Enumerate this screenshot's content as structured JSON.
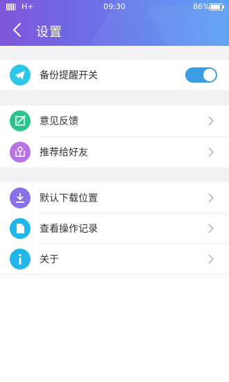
{
  "status_bar": {
    "network": "H+",
    "time": "09:30",
    "battery": "86%",
    "battery_level": 0.86
  },
  "header": {
    "title": "设置"
  },
  "settings": {
    "backup_reminder": {
      "label": "备份提醒开关",
      "enabled": true,
      "icon": "paper-plane-icon",
      "color": "#2cc6e8"
    },
    "feedback": {
      "label": "意见反馈",
      "icon": "feedback-icon",
      "color": "#2bc48a"
    },
    "recommend": {
      "label": "推荐给好友",
      "icon": "gift-icon",
      "color": "#b672e6"
    },
    "download_location": {
      "label": "默认下载位置",
      "icon": "download-icon",
      "color": "#8a70e6"
    },
    "operation_log": {
      "label": "查看操作记录",
      "icon": "document-icon",
      "color": "#1fb6ea"
    },
    "about": {
      "label": "关于",
      "icon": "info-icon",
      "color": "#1fb6ea"
    }
  },
  "colors": {
    "toggle_on": "#3a9ee6",
    "background_gap": "#f2f2f4"
  }
}
